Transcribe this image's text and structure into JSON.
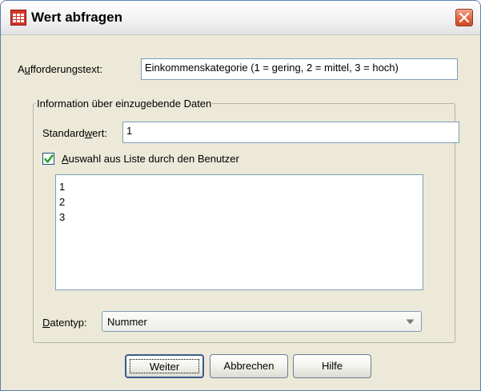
{
  "window": {
    "title": "Wert abfragen"
  },
  "prompt": {
    "label": "Aufforderungstext:",
    "value": "Einkommenskategorie (1 = gering, 2 = mittel, 3 = hoch)"
  },
  "group": {
    "legend": "Information über einzugebende Daten",
    "default_label": "Standardwert:",
    "default_value": "1",
    "checkbox_label": "Auswahl aus Liste durch den Benutzer",
    "checkbox_checked": true,
    "list_items": [
      "1",
      "2",
      "3"
    ],
    "datatype_label": "Datentyp:",
    "datatype_value": "Nummer"
  },
  "buttons": {
    "continue": "Weiter",
    "cancel": "Abbrechen",
    "help": "Hilfe"
  }
}
